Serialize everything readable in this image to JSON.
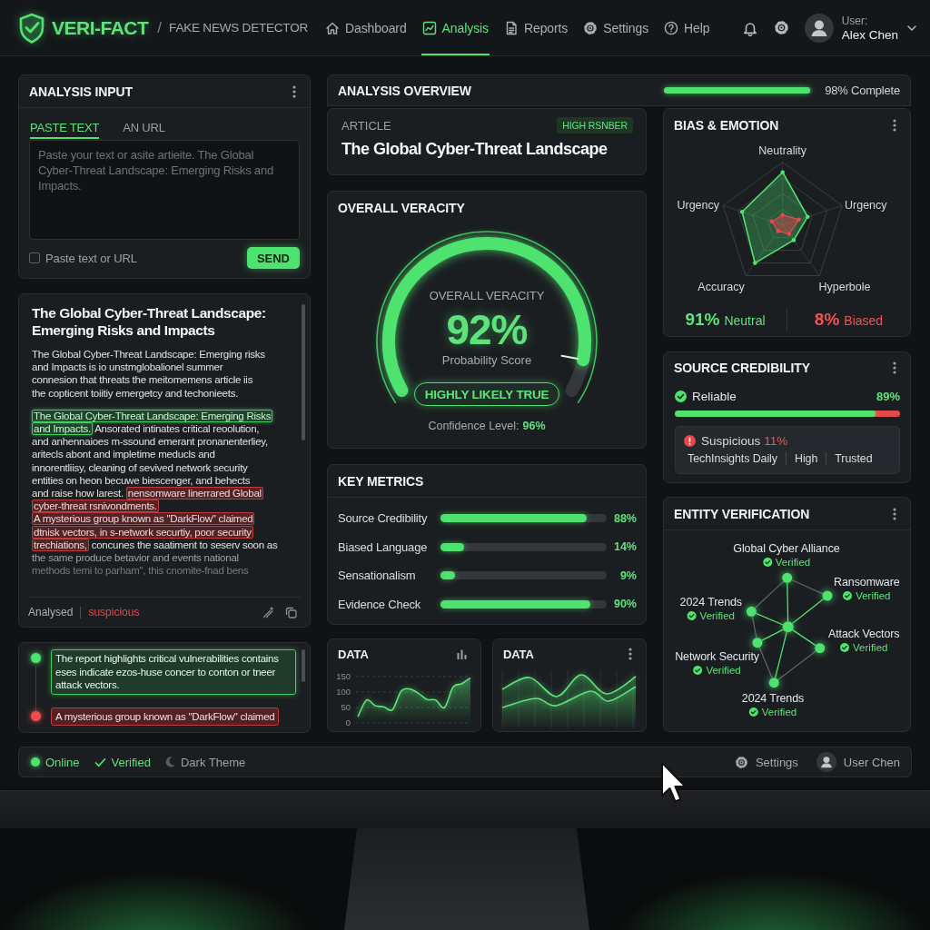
{
  "header": {
    "brand": "VERI-FACT",
    "separator": "/",
    "subtitle": "FAKE NEWS DETECTOR",
    "nav": [
      {
        "label": "Dashboard",
        "selected": false
      },
      {
        "label": "Analysis",
        "selected": true
      },
      {
        "label": "Reports",
        "selected": false
      },
      {
        "label": "Settings",
        "selected": false
      },
      {
        "label": "Help",
        "selected": false
      }
    ],
    "user": {
      "caption": "User:",
      "name": "Alex Chen"
    }
  },
  "analysis_input": {
    "title": "ANALYSIS INPUT",
    "tabs": [
      {
        "label": "PASTE TEXT",
        "selected": true
      },
      {
        "label": "AN URL",
        "selected": false
      }
    ],
    "placeholder": "Paste your text or asite artieite. The Global Cyber-Threat Landscape: Emerging Risks and Impacts.",
    "checkbox": {
      "label": "Paste text or URL",
      "checked": false
    },
    "button": "SEND"
  },
  "article": {
    "title": "The Global Cyber-Threat Landscape: Emerging Risks and Impacts",
    "paragraphs": [
      [
        [
          {
            "kind": "plain",
            "text": "The Global Cyber-Threat Landscape: Emerging risks"
          }
        ],
        [
          {
            "kind": "plain",
            "text": "and Impacts is io unstmglobalionel summer"
          }
        ],
        [
          {
            "kind": "plain",
            "text": "connesion that threats the meitomemens article iis"
          }
        ],
        [
          {
            "kind": "plain",
            "text": "the copticent toiitiy emergetcy and techonieets."
          }
        ]
      ],
      [
        [
          {
            "kind": "verified",
            "text": "The Global Cyber-Threat Landscape: Emerging Risks"
          }
        ],
        [
          {
            "kind": "verified",
            "text": "and Impacts."
          },
          {
            "kind": "plain",
            "text": " Ansorated intinates critical reoolution,"
          }
        ],
        [
          {
            "kind": "plain",
            "text": "and anhennaioes m-ssound emerant pronanenterliey,"
          }
        ],
        [
          {
            "kind": "plain",
            "text": "aritecls abont and impletime meducls and"
          }
        ],
        [
          {
            "kind": "plain",
            "text": "innorentliisy, cleaning of sevived network security"
          }
        ],
        [
          {
            "kind": "plain",
            "text": "entities on heon becuwe biescenger, and behects"
          }
        ],
        [
          {
            "kind": "plain",
            "text": "and raise how larest. "
          },
          {
            "kind": "flagged",
            "text": "nensomware linerrared Global"
          }
        ],
        [
          {
            "kind": "flagged",
            "text": "cyber-threat rsnivondments."
          }
        ],
        [
          {
            "kind": "flagged",
            "text": "A mysterious group known as \"DarkFlow\" claimed"
          }
        ],
        [
          {
            "kind": "flagged",
            "text": "dtnisk vectors, in s-network securtiy, poor security"
          }
        ],
        [
          {
            "kind": "flagged",
            "text": "trechiations,"
          },
          {
            "kind": "plain",
            "text": " concunes the saatiment to seserv soon as"
          }
        ],
        [
          {
            "kind": "dim",
            "text": "the same produce betavior and events national"
          }
        ],
        [
          {
            "kind": "faded",
            "text": "methods temi to parham\", this cnomite-fnad bens"
          }
        ]
      ]
    ],
    "footer": {
      "status": "Analysed",
      "flag": "suspicious"
    }
  },
  "highlights": [
    {
      "kind": "verified",
      "text": "The report highlights critical vulnerabilities contains eses indicate ezos-huse concer to conton or tneer attack vectors."
    },
    {
      "kind": "flagged",
      "text": "A mysterious group known as \"DarkFlow\" claimed"
    }
  ],
  "overview": {
    "title": "ANALYSIS OVERVIEW",
    "progress": {
      "level": 0.98,
      "reading": "98% Complete"
    }
  },
  "article_summary": {
    "label": "ARTICLE",
    "badge": "HIGH RSNBER",
    "title": "The Global Cyber-Threat Landscape"
  },
  "veracity": {
    "title": "OVERALL VERACITY",
    "gauge": {
      "label": "OVERALL VERACITY",
      "level": 0.92,
      "score": "92%",
      "caption": "Probability Score"
    },
    "verdict": "HIGHLY LIKELY TRUE",
    "confidence": {
      "label": "Confidence Level:",
      "value": "96%"
    }
  },
  "key_metrics": {
    "title": "KEY METRICS",
    "rows": [
      {
        "name": "Source Credibility",
        "level": 0.88,
        "reading": "88%"
      },
      {
        "name": "Biased Language",
        "level": 0.14,
        "reading": "14%"
      },
      {
        "name": "Sensationalism",
        "level": 0.09,
        "reading": "9%"
      },
      {
        "name": "Evidence Check",
        "level": 0.9,
        "reading": "90%"
      }
    ]
  },
  "data_panels": [
    {
      "kind": "ticked",
      "chart_data": {
        "type": "area",
        "title": "DATA",
        "ylim": [
          0,
          150
        ],
        "yticks": [
          0,
          50,
          100,
          150
        ],
        "values": [
          20,
          74,
          56,
          52,
          43,
          103,
          110,
          96,
          76,
          74,
          50,
          116,
          127,
          146
        ]
      }
    },
    {
      "kind": "wave",
      "title": "DATA"
    }
  ],
  "bias_emotion": {
    "title": "BIAS & EMOTION",
    "axes": [
      "Neutrality",
      "Urgency",
      "Hyperbole",
      "Accuracy",
      "Urgency"
    ],
    "summary": [
      {
        "kind": "neutral",
        "value": "91%",
        "label": "Neutral"
      },
      {
        "kind": "biased",
        "value": "8%",
        "label": "Biased"
      }
    ]
  },
  "source_credibility": {
    "title": "SOURCE CREDIBILITY",
    "reliable": {
      "label": "Reliable",
      "reading": "89%",
      "level": 0.89
    },
    "suspicious": {
      "label": "Suspicious",
      "reading": "11%"
    },
    "details": [
      "TechInsights Daily",
      "High",
      "Trusted"
    ]
  },
  "entity_verification": {
    "title": "ENTITY VERIFICATION",
    "entities": [
      {
        "name": "Global Cyber Alliance",
        "status": "Verified"
      },
      {
        "name": "Ransomware",
        "status": "Verified"
      },
      {
        "name": "2024 Trends",
        "status": "Verified"
      },
      {
        "name": "Attack Vectors",
        "status": "Verified"
      },
      {
        "name": "Network Security",
        "status": "Verified"
      },
      {
        "name": "2024 Trends",
        "status": "Verified"
      }
    ]
  },
  "status_bar": {
    "items": [
      {
        "kind": "online",
        "label": "Online"
      },
      {
        "kind": "verified",
        "label": "Verified"
      },
      {
        "kind": "theme",
        "label": "Dark Theme"
      }
    ],
    "settings": "Settings",
    "user": "User Chen"
  }
}
